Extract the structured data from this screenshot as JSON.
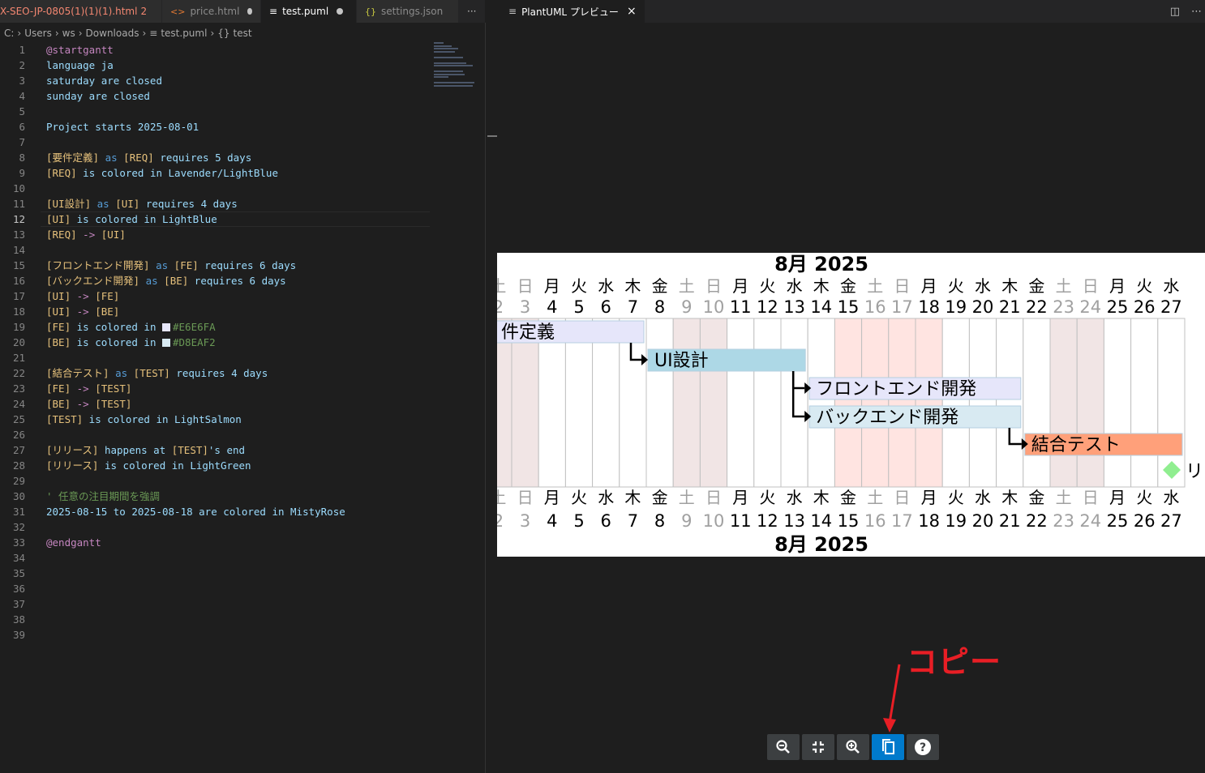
{
  "tabs": [
    {
      "label": "X-SEO-JP-0805(1)(1)(1).html",
      "badge": "2",
      "icon": "html-file-icon"
    },
    {
      "label": "price.html",
      "icon": "html-file-icon"
    },
    {
      "label": "test.puml",
      "icon": "text-file-icon"
    },
    {
      "label": "settings.json",
      "icon": "json-file-icon"
    }
  ],
  "more_label": "···",
  "breadcrumb": [
    "C:",
    "Users",
    "ws",
    "Downloads",
    "test.puml",
    "test"
  ],
  "code": {
    "l1": "@startgantt",
    "l2": "language ja",
    "l3": "saturday are closed",
    "l4": "sunday are closed",
    "l6a": "Project starts ",
    "l6b": "2025-08-01",
    "l8a": "[要件定義]",
    "l8b": " as ",
    "l8c": "[REQ]",
    "l8d": " requires 5 days",
    "l9a": "[REQ]",
    "l9b": " is colored in Lavender/LightBlue",
    "l11a": "[UI設計]",
    "l11b": " as ",
    "l11c": "[UI]",
    "l11d": " requires 4 days",
    "l12a": "[UI]",
    "l12b": " is colored in LightBlue",
    "l13a": "[REQ]",
    "l13b": " -> ",
    "l13c": "[UI]",
    "l15a": "[フロントエンド開発]",
    "l15b": " as ",
    "l15c": "[FE]",
    "l15d": " requires 6 days",
    "l16a": "[バックエンド開発]",
    "l16b": " as ",
    "l16c": "[BE]",
    "l16d": " requires 6 days",
    "l17a": "[UI]",
    "l17b": " -> ",
    "l17c": "[FE]",
    "l18a": "[UI]",
    "l18b": " -> ",
    "l18c": "[BE]",
    "l19a": "[FE]",
    "l19b": " is colored in ",
    "l19c": "#E6E6FA",
    "l20a": "[BE]",
    "l20b": " is colored in ",
    "l20c": "#D8EAF2",
    "l22a": "[結合テスト]",
    "l22b": " as ",
    "l22c": "[TEST]",
    "l22d": " requires 4 days",
    "l23a": "[FE]",
    "l23b": " -> ",
    "l23c": "[TEST]",
    "l24a": "[BE]",
    "l24b": " -> ",
    "l24c": "[TEST]",
    "l25a": "[TEST]",
    "l25b": " is colored in LightSalmon",
    "l27a": "[リリース]",
    "l27b": " happens at ",
    "l27c": "[TEST]",
    "l27d": "'s end",
    "l28a": "[リリース]",
    "l28b": " is colored in LightGreen",
    "l30": "' 任意の注目期間を強調",
    "l31": "2025-08-15 to 2025-08-18 are colored in MistyRose",
    "l33": "@endgantt"
  },
  "preview": {
    "tab_label": "PlantUML プレビュー",
    "close": "×",
    "month_label": "8月 2025",
    "days": [
      {
        "d": "2",
        "w": "土",
        "closed": true
      },
      {
        "d": "3",
        "w": "日",
        "closed": true
      },
      {
        "d": "4",
        "w": "月"
      },
      {
        "d": "5",
        "w": "火"
      },
      {
        "d": "6",
        "w": "水"
      },
      {
        "d": "7",
        "w": "木"
      },
      {
        "d": "8",
        "w": "金"
      },
      {
        "d": "9",
        "w": "土",
        "closed": true
      },
      {
        "d": "10",
        "w": "日",
        "closed": true
      },
      {
        "d": "11",
        "w": "月"
      },
      {
        "d": "12",
        "w": "火"
      },
      {
        "d": "13",
        "w": "水"
      },
      {
        "d": "14",
        "w": "木"
      },
      {
        "d": "15",
        "w": "金",
        "highlight": true
      },
      {
        "d": "16",
        "w": "土",
        "closed": true,
        "highlight": true
      },
      {
        "d": "17",
        "w": "日",
        "closed": true,
        "highlight": true
      },
      {
        "d": "18",
        "w": "月",
        "highlight": true
      },
      {
        "d": "19",
        "w": "火"
      },
      {
        "d": "20",
        "w": "水"
      },
      {
        "d": "21",
        "w": "木"
      },
      {
        "d": "22",
        "w": "金"
      },
      {
        "d": "23",
        "w": "土",
        "closed": true
      },
      {
        "d": "24",
        "w": "日",
        "closed": true
      },
      {
        "d": "25",
        "w": "月"
      },
      {
        "d": "26",
        "w": "火"
      },
      {
        "d": "27",
        "w": "水"
      }
    ],
    "tasks": [
      {
        "name": "件定義",
        "start": "2025-08-01",
        "end": "2025-08-07",
        "color": "#E6E6FA"
      },
      {
        "name": "UI設計",
        "start": "2025-08-08",
        "end": "2025-08-13",
        "color": "#ADD8E6"
      },
      {
        "name": "フロントエンド開発",
        "start": "2025-08-14",
        "end": "2025-08-21",
        "color": "#E6E6FA"
      },
      {
        "name": "バックエンド開発",
        "start": "2025-08-14",
        "end": "2025-08-21",
        "color": "#D8EAF2"
      },
      {
        "name": "結合テスト",
        "start": "2025-08-22",
        "end": "2025-08-27",
        "color": "#FFA07A"
      }
    ],
    "milestone": {
      "name": "リ",
      "date": "2025-08-27",
      "color": "#90EE90"
    },
    "colors": {
      "closed": "#f1e5e5",
      "highlight": "#FFE4E1",
      "grid": "#c0c0c0",
      "closed_text": "#a0a0a0"
    },
    "toolbar": [
      "zoom-out-icon",
      "fit-icon",
      "zoom-in-icon",
      "copy-icon",
      "help-icon"
    ],
    "annotation": "コピー"
  }
}
